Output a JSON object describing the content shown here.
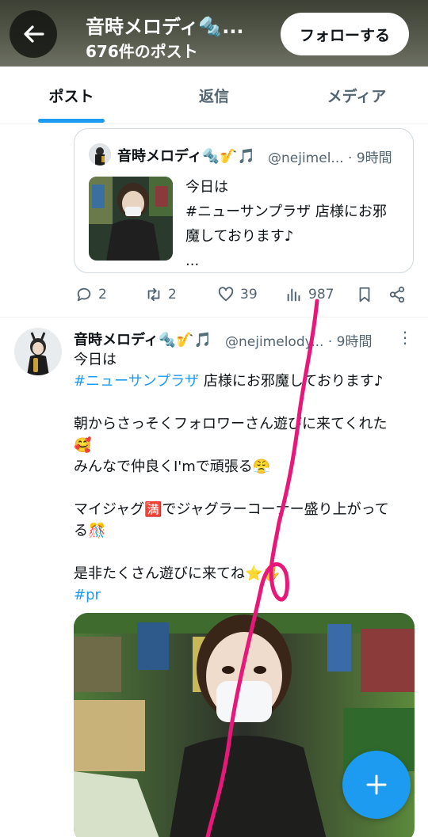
{
  "header": {
    "title": "音時メロディ🔩...",
    "post_count": "676件のポスト",
    "follow_label": "フォローする",
    "bg_color": "#55594c"
  },
  "tabs": [
    {
      "label": "ポスト",
      "active": true
    },
    {
      "label": "返信",
      "active": false
    },
    {
      "label": "メディア",
      "active": false
    }
  ],
  "accent_color": "#1d9bf0",
  "quoted_post": {
    "name": "音時メロディ🔩🎷🎵",
    "handle": "@nejimel... · 9時間",
    "text_lines": [
      "今日は",
      "#ニューサンプラザ 店様にお邪",
      "魔しております♪",
      "..."
    ]
  },
  "actions": {
    "replies": "2",
    "reposts": "2",
    "likes": "39",
    "views": "987",
    "icons": [
      "reply-icon",
      "repost-icon",
      "like-icon",
      "views-icon",
      "bookmark-icon",
      "share-icon"
    ]
  },
  "post": {
    "name": "音時メロディ🔩🎷🎵",
    "handle": "@nejimelody... · 9時間",
    "line1": "今日は",
    "line2_tag": "#ニューサンプラザ",
    "line2_rest": " 店様にお邪魔しております♪",
    "line3": "朝からさっそくフォロワーさん遊びに来てくれた",
    "line4": "🥰",
    "line5": "みんなで仲良くI'mで頑張る😤",
    "line6": "マイジャグ🈵でジャグラーコーナー盛り上がって",
    "line7": "る🎊",
    "line8": "是非たくさん遊びに来てね⭐🖐",
    "line9_tag": "#pr"
  },
  "fab_label": "+"
}
